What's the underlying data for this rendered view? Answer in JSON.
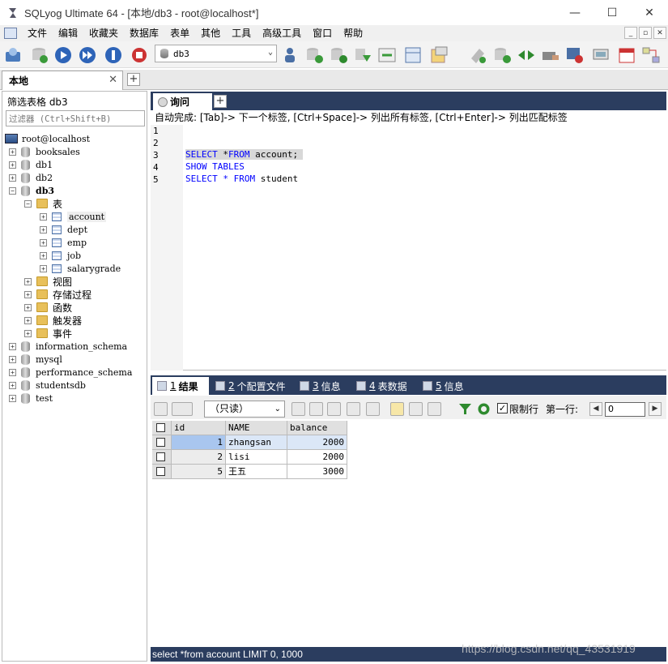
{
  "window": {
    "title": "SQLyog Ultimate 64 - [本地/db3 - root@localhost*]",
    "controls": {
      "minimize": "—",
      "maximize": "☐",
      "close": "✕"
    }
  },
  "menu": [
    "文件",
    "编辑",
    "收藏夹",
    "数据库",
    "表单",
    "其他",
    "工具",
    "高级工具",
    "窗口",
    "帮助"
  ],
  "toolbar": {
    "database_selected": "db3"
  },
  "connection_tabs": [
    {
      "label": "本地",
      "close": "✕"
    }
  ],
  "object_browser": {
    "filter_title": "筛选表格 db3",
    "filter_placeholder": "过滤器 (Ctrl+Shift+B)",
    "server": "root@localhost",
    "databases_top": [
      "booksales",
      "db1",
      "db2"
    ],
    "active_db": "db3",
    "tables_folder": "表",
    "tables": [
      "account",
      "dept",
      "emp",
      "job",
      "salarygrade"
    ],
    "db3_folders": [
      "视图",
      "存储过程",
      "函数",
      "触发器",
      "事件"
    ],
    "databases_bottom": [
      "information_schema",
      "mysql",
      "performance_schema",
      "studentsdb",
      "test"
    ]
  },
  "query_tab": {
    "label": "询问"
  },
  "autocomplete_hint": "自动完成: [Tab]-> 下一个标签, [Ctrl+Space]-> 列出所有标签, [Ctrl+Enter]-> 列出匹配标签",
  "editor": {
    "line_numbers": [
      "1",
      "2",
      "3",
      "4",
      "5"
    ],
    "lines": [
      {
        "kw1": "SELECT",
        "mid1": " *",
        "kw2": "FROM",
        "rest": " account;"
      },
      {
        "kw1": "SHOW TABLES"
      },
      {
        "kw1": "SELECT",
        "mid1": " * ",
        "kw2": "FROM",
        "rest": " student"
      }
    ]
  },
  "result_tabs": [
    {
      "num": "1",
      "label": "结果"
    },
    {
      "num": "2",
      "label": "个配置文件"
    },
    {
      "num": "3",
      "label": "信息"
    },
    {
      "num": "4",
      "label": "表数据"
    },
    {
      "num": "5",
      "label": "信息"
    }
  ],
  "result_toolbar": {
    "mode": "（只读）",
    "limit_label": "限制行",
    "limit_checked": "✓",
    "first_row_label": "第一行:",
    "first_row_value": "0",
    "prev": "◀",
    "next": "▶"
  },
  "grid": {
    "columns": [
      "id",
      "NAME",
      "balance"
    ],
    "rows": [
      [
        "1",
        "zhangsan",
        "2000"
      ],
      [
        "2",
        "lisi",
        "2000"
      ],
      [
        "5",
        "王五",
        "3000"
      ]
    ]
  },
  "status": "select *from account LIMIT 0, 1000",
  "watermark": "https://blog.csdn.net/qq_43531919",
  "colors": {
    "tab_bar": "#2b3d5f",
    "keyword": "#0000ff",
    "selected_cell": "#a9c6ef"
  }
}
